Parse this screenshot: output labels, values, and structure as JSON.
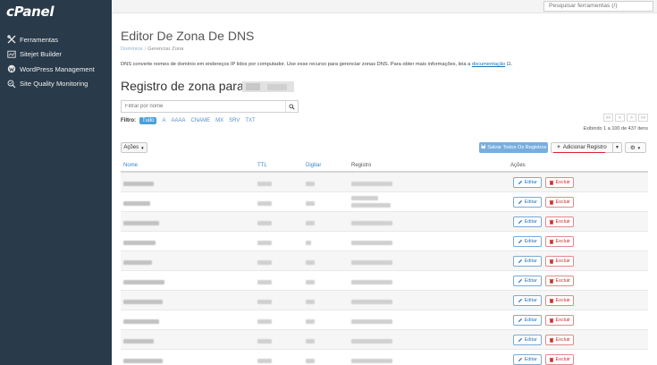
{
  "brand": {
    "logo_text": "cPanel"
  },
  "sidebar": {
    "items": [
      {
        "label": "Ferramentas",
        "icon": "tools-icon"
      },
      {
        "label": "Sitejet Builder",
        "icon": "sitejet-icon"
      },
      {
        "label": "WordPress Management",
        "icon": "wordpress-icon"
      },
      {
        "label": "Site Quality Monitoring",
        "icon": "monitoring-icon"
      }
    ]
  },
  "topbar": {
    "search_placeholder": "Pesquisar ferramentas (/)"
  },
  "page": {
    "title": "Editor De Zona De DNS",
    "breadcrumb_root": "Domínios",
    "breadcrumb_current": "Gerenciar Zona",
    "description": "DNS converte nomes de domínio em endereços IP lidos por computador. Use esse recurso para gerenciar zonas DNS. Para obter mais informações, leia a ",
    "description_link": "documentação",
    "zone_title": "Registro de zona para"
  },
  "filter": {
    "placeholder": "Filtrar por nome",
    "label": "Filtro:",
    "options": [
      "Tudo",
      "A",
      "AAAA",
      "CNAME",
      "MX",
      "SRV",
      "TXT"
    ],
    "active": "Tudo"
  },
  "pagination": {
    "buttons": [
      "<<",
      "<",
      ">",
      ">>"
    ],
    "showing_text": "Exibindo 1 a 100 de 437 itens"
  },
  "toolbar": {
    "actions_label": "Ações",
    "save_all_label": "Salvar Todos Os Registros",
    "add_record_label": "Adicionar Registro"
  },
  "table": {
    "headers": {
      "name": "Nome",
      "ttl": "TTL",
      "type": "Digitar",
      "record": "Registro",
      "actions": "Ações"
    },
    "edit_label": "Editar",
    "delete_label": "Excluir",
    "row_count": 10
  },
  "colors": {
    "sidebar_bg": "#293a4a",
    "accent_blue": "#3a86c8",
    "delete_red": "#c9302c",
    "highlight_red": "#d9232e"
  }
}
